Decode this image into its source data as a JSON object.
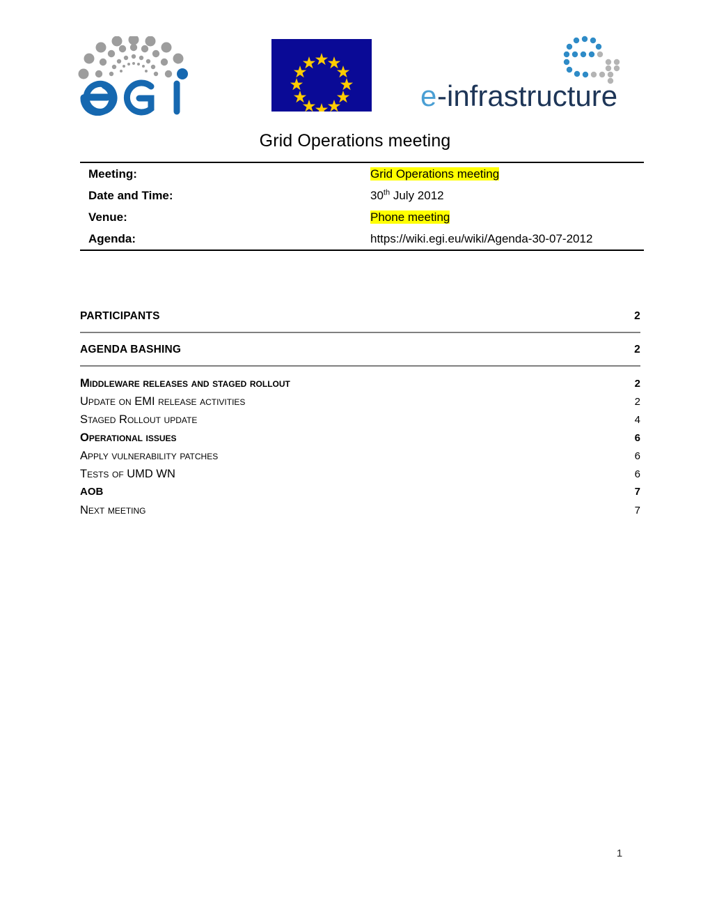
{
  "header": {
    "logos": [
      {
        "name": "egi-logo",
        "alt": "EGI",
        "wordmark": "egi",
        "colors": {
          "dots": "#9d9d9d",
          "accent_dot": "#1668b0",
          "word": "#1668b0"
        }
      },
      {
        "name": "eu-flag",
        "alt": "European Union flag",
        "stars": 12,
        "colors": {
          "field": "#0a0a96",
          "star": "#ffcc00"
        }
      },
      {
        "name": "e-infrastructure-logo",
        "alt": "e-infrastructure",
        "wordmark_prefix": "e",
        "wordmark_rest": "-infrastructure",
        "colors": {
          "dots_blue": "#2e8bc7",
          "dots_grey": "#b4b4b4",
          "prefix": "#4a9fd4",
          "rest": "#1d3557"
        }
      }
    ]
  },
  "document": {
    "title": "Grid Operations meeting",
    "page_number": "1"
  },
  "info_table": {
    "rows": [
      {
        "label": "Meeting:",
        "value": "Grid Operations meeting",
        "highlight": true
      },
      {
        "label": "Date and Time:",
        "value_main": "30",
        "value_sup": "th",
        "value_rest": " July 2012",
        "highlight": false
      },
      {
        "label": "Venue:",
        "value": "Phone meeting",
        "highlight": true
      },
      {
        "label": "Agenda:",
        "value": "https://wiki.egi.eu/wiki/Agenda-30-07-2012",
        "highlight": false
      }
    ]
  },
  "toc": {
    "entries": [
      {
        "label": "PARTICIPANTS",
        "page": "2",
        "level": 1
      },
      {
        "label": "AGENDA BASHING",
        "page": "2",
        "level": 1
      },
      {
        "label": "Middleware releases and staged rollout",
        "page": "2",
        "level": 2
      },
      {
        "label": "Update on EMI release activities",
        "page": "2",
        "level": 3
      },
      {
        "label": "Staged Rollout update",
        "page": "4",
        "level": 3
      },
      {
        "label": "Operational issues",
        "page": "6",
        "level": 2
      },
      {
        "label": "Apply vulnerability patches",
        "page": "6",
        "level": 3
      },
      {
        "label": "Tests of UMD WN",
        "page": "6",
        "level": 3
      },
      {
        "label": "AOB",
        "page": "7",
        "level": 2
      },
      {
        "label": "Next meeting",
        "page": "7",
        "level": 3
      }
    ]
  },
  "colors": {
    "highlight": "#ffff00",
    "rule": "#000000",
    "toc_rule": "#808080"
  }
}
